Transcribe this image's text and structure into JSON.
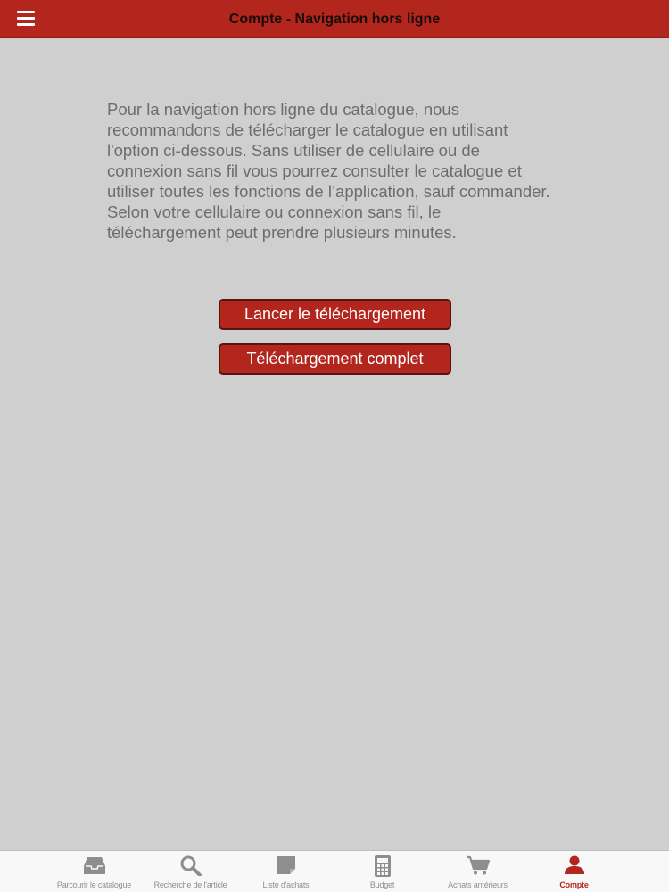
{
  "header": {
    "title": "Compte - Navigation hors ligne",
    "menu_icon": "hamburger-menu-icon"
  },
  "main": {
    "intro_text": "Pour la navigation hors ligne du catalogue, nous recommandons de télécharger le catalogue en utilisant l'option ci-dessous. Sans utiliser de cellulaire ou de connexion sans fil vous pourrez consulter le catalogue et utiliser toutes les fonctions de l’application, sauf commander. Selon votre cellulaire ou connexion sans fil, le téléchargement peut prendre plusieurs minutes.",
    "start_download_label": "Lancer le téléchargement",
    "full_download_label": "Téléchargement complet"
  },
  "tabbar": {
    "active_tab": "Compte",
    "tabs": [
      {
        "label": "Parcourir le catalogue",
        "icon": "inbox-tray-icon"
      },
      {
        "label": "Recherche de l'article",
        "icon": "search-icon"
      },
      {
        "label": "Liste d'achats",
        "icon": "note-icon"
      },
      {
        "label": "Budget",
        "icon": "calculator-icon"
      },
      {
        "label": "Achats antérieurs",
        "icon": "cart-icon"
      },
      {
        "label": "Compte",
        "icon": "user-icon"
      }
    ]
  },
  "colors": {
    "brand_red": "#b3261e",
    "background": "#cfcfcf",
    "inactive_tab": "#8e8e8e"
  }
}
